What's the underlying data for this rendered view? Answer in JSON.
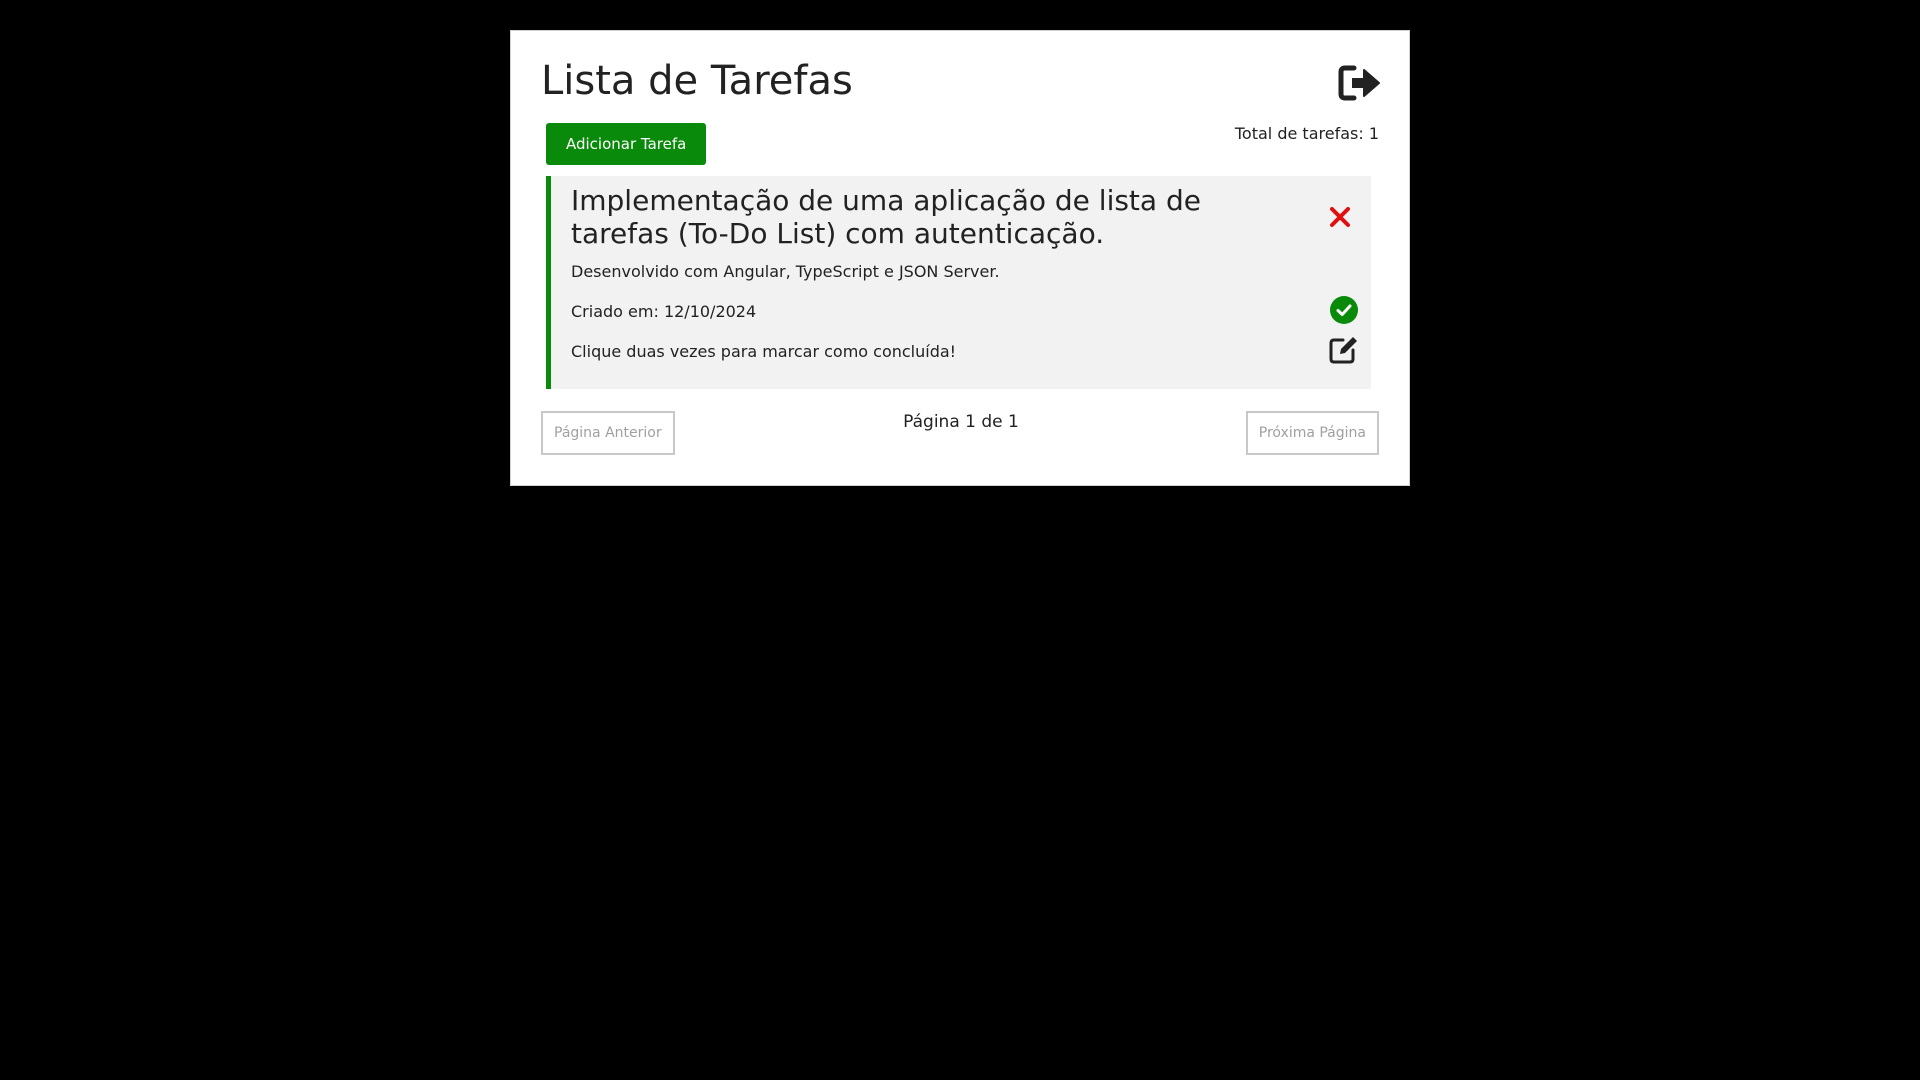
{
  "header": {
    "title": "Lista de Tarefas",
    "logout_icon": "sign-out-icon"
  },
  "toolbar": {
    "add_task_label": "Adicionar Tarefa",
    "total_label": "Total de tarefas: 1"
  },
  "tasks": [
    {
      "title": "Implementação de uma aplicação de lista de tarefas (To-Do List) com autenticação.",
      "description": "Desenvolvido com Angular, TypeScript e JSON Server.",
      "created": "Criado em: 12/10/2024",
      "hint": "Clique duas vezes para marcar como concluída!",
      "icons": [
        "close-icon",
        "check-circle-icon",
        "edit-icon"
      ]
    }
  ],
  "pagination": {
    "prev_label": "Página Anterior",
    "page_info": "Página 1 de 1",
    "next_label": "Próxima Página"
  },
  "colors": {
    "accent": "#0a8a0a",
    "delete": "#e01010",
    "background": "#000000",
    "card": "#ffffff",
    "task_bg": "#f2f2f2"
  }
}
